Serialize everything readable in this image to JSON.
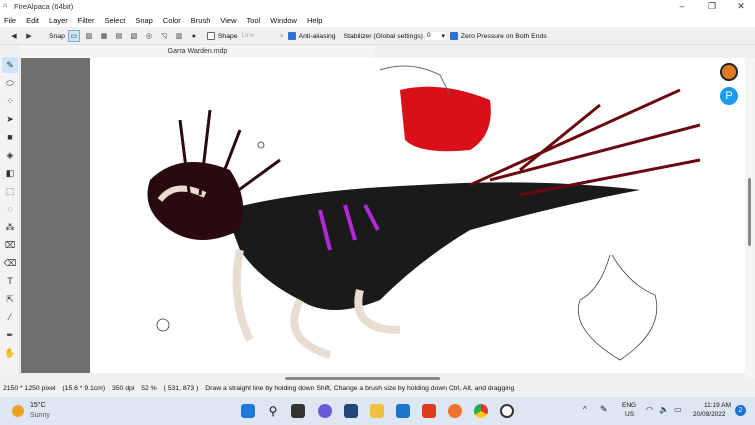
{
  "window": {
    "title": "FireAlpaca (64bit)",
    "controls": [
      "minimize",
      "restore",
      "close"
    ]
  },
  "menu": [
    "File",
    "Edit",
    "Layer",
    "Filter",
    "Select",
    "Snap",
    "Color",
    "Brush",
    "View",
    "Tool",
    "Window",
    "Help"
  ],
  "toolbar": {
    "snap_label": "Snap",
    "shape_label": "Shape",
    "shape_value": "Line",
    "antialias_label": "Anti-aliasing",
    "antialias_checked": true,
    "stabilizer_label": "Stabilizer (Global settings)",
    "stabilizer_value": "0",
    "zero_pressure_label": "Zero Pressure on Both Ends",
    "zero_pressure_checked": true
  },
  "document": {
    "tab": "Garra Warden.mdp"
  },
  "tools": [
    "pen-icon",
    "eraser-icon",
    "dot-icon",
    "move-icon",
    "fill-rect-icon",
    "bucket-icon",
    "gradient-icon",
    "select-rect-icon",
    "lasso-icon",
    "magic-wand-icon",
    "select-pen-icon",
    "select-eraser-icon",
    "text-icon",
    "operation-icon",
    "blur-icon",
    "eyedropper-icon",
    "hand-icon"
  ],
  "status": {
    "size": "2150 * 1250 pixel",
    "cm": "(15.6 * 9.1cm)",
    "dpi": "350 dpi",
    "zoom": "52 %",
    "coords": "( 531, 873 )",
    "hint": "Draw a straight line by holding down Shift, Change a brush size by holding down Ctrl, Alt, and dragging"
  },
  "taskbar": {
    "weather_temp": "15°C",
    "weather_desc": "Sunny",
    "lang1": "ENG",
    "lang2": "US",
    "time": "11:19 AM",
    "date": "20/09/2022",
    "notifications": "2"
  }
}
